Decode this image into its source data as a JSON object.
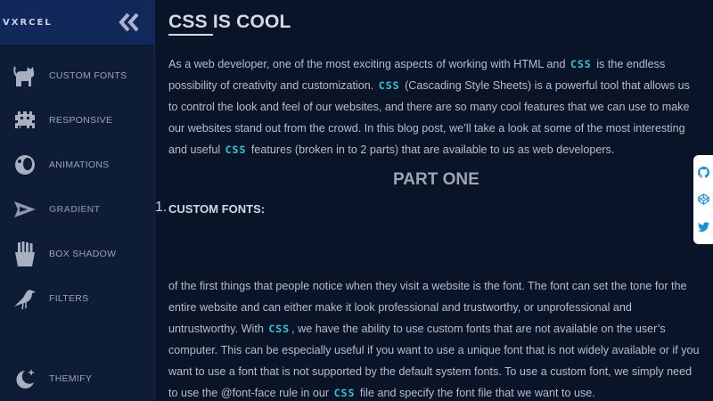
{
  "brand": "VXRCEL",
  "nav": [
    {
      "label": "CUSTOM FONTS",
      "icon": "cat-icon"
    },
    {
      "label": "RESPONSIVE",
      "icon": "space-invader-icon"
    },
    {
      "label": "ANIMATIONS",
      "icon": "planet-icon"
    },
    {
      "label": "GRADIENT",
      "icon": "spaceship-icon"
    },
    {
      "label": "BOX SHADOW",
      "icon": "fries-icon"
    },
    {
      "label": "FILTERS",
      "icon": "crow-icon"
    }
  ],
  "themify": {
    "label": "THEMIFY",
    "icon": "moon-icon"
  },
  "article": {
    "title": "CSS IS COOL",
    "intro": [
      "As a web developer, one of the most exciting aspects of working with HTML and ",
      {
        "code": "CSS"
      },
      " is the endless possibility of creativity and customization. ",
      {
        "code": "CSS"
      },
      " (Cascading Style Sheets) is a powerful tool that allows us to control the look and feel of our websites, and there are so many cool features that we can use to make our websites stand out from the crowd. In this blog post, we’ll take a look at some of the most interesting and useful ",
      {
        "code": "CSS"
      },
      " features (broken in to 2 parts) that are available to us as web developers."
    ],
    "part_heading": "PART ONE",
    "list_number": "1.",
    "section_heading": "CUSTOM FONTS:",
    "section_body": [
      "of the first things that people notice when they visit a website is the font. The font can set the tone for the entire website and can either make it look professional and trustworthy, or unprofessional and untrustworthy. With ",
      {
        "code": "CSS"
      },
      ", we have the ability to use custom fonts that are not available on the user’s computer. This can be especially useful if you want to use a unique font that is not widely available or if you want to use a font that is not supported by the default system fonts. To use a custom font, we simply need to use the @font-face rule in our ",
      {
        "code": "CSS"
      },
      " file and specify the font file that we want to use."
    ]
  },
  "social": [
    {
      "icon": "github-icon"
    },
    {
      "icon": "codepen-icon"
    },
    {
      "icon": "twitter-icon"
    }
  ],
  "colors": {
    "accent": "#2fc6d8",
    "sidebar": "#0f1c36",
    "background": "#0a1428",
    "brand_bar": "#12275a"
  }
}
